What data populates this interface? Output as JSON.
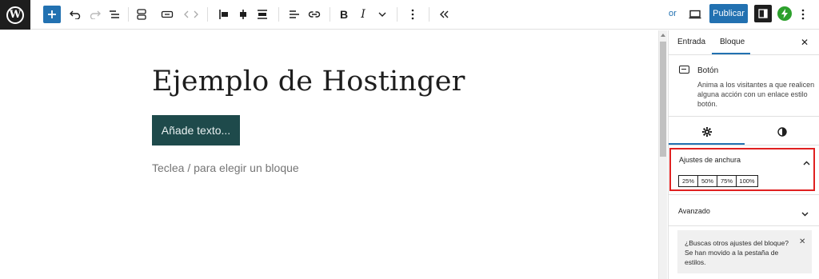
{
  "toolbar": {
    "logo_letter": "W",
    "preview_label": "or",
    "publish_label": "Publicar"
  },
  "canvas": {
    "title": "Ejemplo de Hostinger",
    "button_text": "Añade texto...",
    "placeholder": "Teclea / para elegir un bloque"
  },
  "sidebar": {
    "tabs": [
      "Entrada",
      "Bloque"
    ],
    "active_tab": "Bloque",
    "close_glyph": "✕",
    "block": {
      "name": "Botón",
      "description": "Anima a los visitantes a que realicen alguna acción con un enlace estilo botón."
    },
    "width_panel": {
      "title": "Ajustes de anchura",
      "options": [
        "25%",
        "50%",
        "75%",
        "100%"
      ]
    },
    "advanced_title": "Avanzado",
    "notice": "¿Buscas otros ajustes del bloque? Se han movido a la pestaña de estilos.",
    "notice_close": "✕"
  },
  "colors": {
    "accent": "#2271b1",
    "button_block": "#1e4a4b",
    "highlight": "#e02020"
  }
}
